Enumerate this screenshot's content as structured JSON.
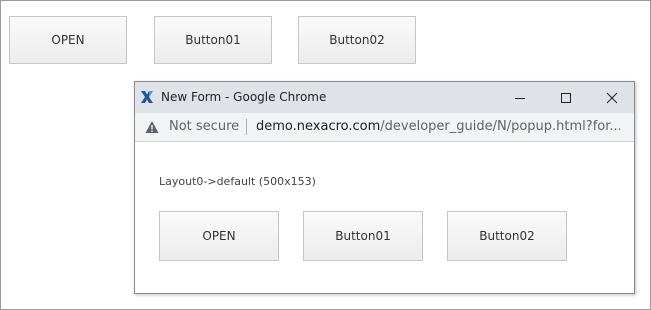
{
  "main": {
    "buttons": [
      {
        "label": "OPEN"
      },
      {
        "label": "Button01"
      },
      {
        "label": "Button02"
      }
    ]
  },
  "popup": {
    "title": "New Form - Google Chrome",
    "window_controls": [
      "minimize-icon",
      "maximize-icon",
      "close-icon"
    ],
    "address": {
      "security_label": "Not secure",
      "host": "demo.nexacro.com",
      "path": "/developer_guide/N/popup.html?for..."
    },
    "layout_label": "Layout0->default (500x153)",
    "buttons": [
      {
        "label": "OPEN"
      },
      {
        "label": "Button01"
      },
      {
        "label": "Button02"
      }
    ]
  },
  "colors": {
    "titlebar": "#dfe3e8",
    "urlbar": "#f1f3f4",
    "app_icon": "#1e5799"
  }
}
